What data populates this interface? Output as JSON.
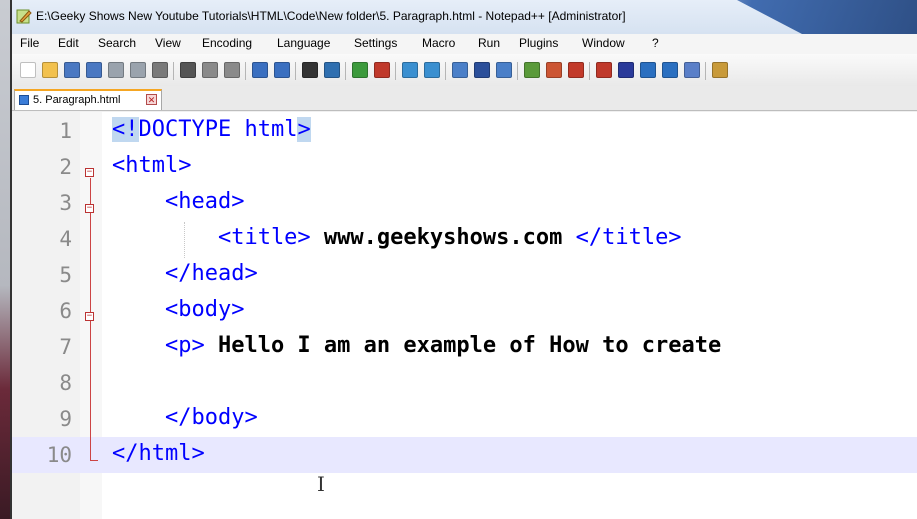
{
  "window": {
    "title": "E:\\Geeky Shows New Youtube Tutorials\\HTML\\Code\\New folder\\5. Paragraph.html - Notepad++ [Administrator]"
  },
  "menu": [
    "File",
    "Edit",
    "Search",
    "View",
    "Encoding",
    "Language",
    "Settings",
    "Macro",
    "Run",
    "Plugins",
    "Window",
    "?"
  ],
  "tab": {
    "label": "5. Paragraph.html",
    "close": "✕"
  },
  "editor": {
    "current_line": 10,
    "lines": [
      {
        "n": "1",
        "parts": [
          {
            "t": "<!",
            "c": "tag hl"
          },
          {
            "t": "DOCTYPE html",
            "c": "tag"
          },
          {
            "t": ">",
            "c": "tag hl"
          }
        ]
      },
      {
        "n": "2",
        "parts": [
          {
            "t": "<html>",
            "c": "tag"
          }
        ]
      },
      {
        "n": "3",
        "parts": [
          {
            "t": "    <head>",
            "c": "tag"
          }
        ]
      },
      {
        "n": "4",
        "parts": [
          {
            "t": "        <title>",
            "c": "tag"
          },
          {
            "t": " www.geekyshows.com ",
            "c": "txt"
          },
          {
            "t": "</title>",
            "c": "tag"
          }
        ]
      },
      {
        "n": "5",
        "parts": [
          {
            "t": "    </head>",
            "c": "tag"
          }
        ]
      },
      {
        "n": "6",
        "parts": [
          {
            "t": "    <body>",
            "c": "tag"
          }
        ]
      },
      {
        "n": "7",
        "parts": [
          {
            "t": "    <p>",
            "c": "tag"
          },
          {
            "t": " Hello I am an example of How to create",
            "c": "txt"
          }
        ]
      },
      {
        "n": "8",
        "parts": []
      },
      {
        "n": "9",
        "parts": [
          {
            "t": "    </body>",
            "c": "tag"
          }
        ]
      },
      {
        "n": "10",
        "parts": [
          {
            "t": "</html>",
            "c": "tag"
          }
        ]
      }
    ]
  },
  "icons": [
    "new-file-icon",
    "open-file-icon",
    "save-icon",
    "save-all-icon",
    "close-icon",
    "close-all-icon",
    "print-icon",
    "cut-icon",
    "copy-icon",
    "paste-icon",
    "undo-icon",
    "redo-icon",
    "find-icon",
    "replace-icon",
    "zoom-in-icon",
    "zoom-out-icon",
    "sync-v-icon",
    "sync-h-icon",
    "wrap-icon",
    "all-chars-icon",
    "indent-guide-icon",
    "udl-icon",
    "doc-map-icon",
    "function-list-icon",
    "record-macro-icon",
    "stop-macro-icon",
    "play-macro-icon",
    "run-macro-multi-icon",
    "save-macro-icon",
    "launch-browser-icon"
  ],
  "colors": {
    "tag": "#0000ff",
    "text": "#000000",
    "current_line": "#e8e8ff",
    "fold_marker": "#cc4444"
  }
}
